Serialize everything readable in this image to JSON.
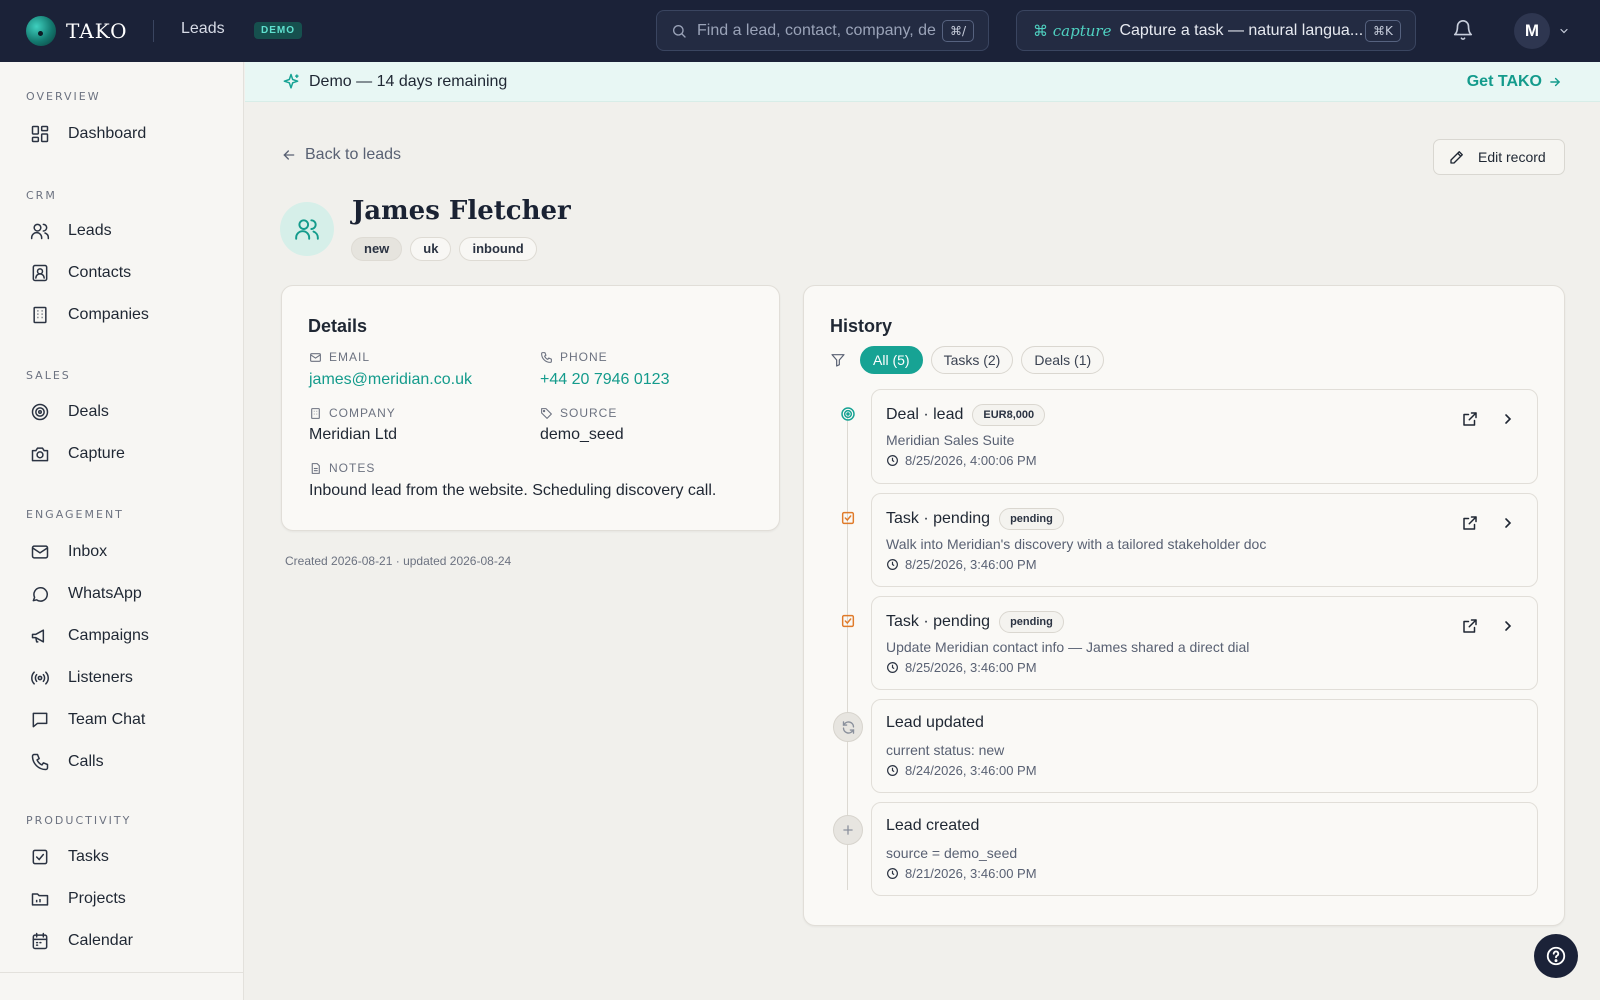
{
  "app": {
    "brand": "TAKO",
    "section": "Leads",
    "demo_badge": "DEMO",
    "search_placeholder": "Find a lead, contact, company, de",
    "search_shortcut": "⌘/",
    "capture_brand": "⌘ capture",
    "capture_text": "Capture a task — natural langua...",
    "capture_shortcut": "⌘K",
    "user_initial": "M"
  },
  "sidebar": {
    "sections": [
      {
        "heading": "OVERVIEW",
        "items": [
          {
            "label": "Dashboard",
            "icon": "dashboard-icon"
          }
        ]
      },
      {
        "heading": "CRM",
        "items": [
          {
            "label": "Leads",
            "icon": "users-icon"
          },
          {
            "label": "Contacts",
            "icon": "contact-card-icon"
          },
          {
            "label": "Companies",
            "icon": "building-icon"
          }
        ]
      },
      {
        "heading": "SALES",
        "items": [
          {
            "label": "Deals",
            "icon": "target-icon"
          },
          {
            "label": "Capture",
            "icon": "camera-icon"
          }
        ]
      },
      {
        "heading": "ENGAGEMENT",
        "items": [
          {
            "label": "Inbox",
            "icon": "mail-icon"
          },
          {
            "label": "WhatsApp",
            "icon": "chat-bubble-icon"
          },
          {
            "label": "Campaigns",
            "icon": "megaphone-icon"
          },
          {
            "label": "Listeners",
            "icon": "broadcast-icon"
          },
          {
            "label": "Team Chat",
            "icon": "message-square-icon"
          },
          {
            "label": "Calls",
            "icon": "phone-icon"
          }
        ]
      },
      {
        "heading": "PRODUCTIVITY",
        "items": [
          {
            "label": "Tasks",
            "icon": "checkbox-icon"
          },
          {
            "label": "Projects",
            "icon": "folder-icon"
          },
          {
            "label": "Calendar",
            "icon": "calendar-icon"
          }
        ]
      }
    ]
  },
  "banner": {
    "message": "Demo — 14 days remaining",
    "cta": "Get TAKO"
  },
  "page": {
    "back_label": "Back to leads",
    "edit_label": "Edit record",
    "lead_name": "James Fletcher",
    "tags": [
      "new",
      "uk",
      "inbound"
    ]
  },
  "details": {
    "title": "Details",
    "email_label": "EMAIL",
    "email": "james@meridian.co.uk",
    "phone_label": "PHONE",
    "phone": "+44 20 7946 0123",
    "company_label": "COMPANY",
    "company": "Meridian Ltd",
    "source_label": "SOURCE",
    "source": "demo_seed",
    "notes_label": "NOTES",
    "notes": "Inbound lead from the website. Scheduling discovery call.",
    "meta": "Created 2026-08-21 · updated 2026-08-24"
  },
  "history": {
    "title": "History",
    "filters": [
      "All (5)",
      "Tasks (2)",
      "Deals (1)"
    ],
    "active_filter": "All (5)",
    "entries": [
      {
        "title": "Deal · lead",
        "badge": "EUR8,000",
        "subtitle": "Meridian Sales Suite",
        "time": "8/25/2026, 4:00:06 PM",
        "icon": "target-icon"
      },
      {
        "title": "Task · pending",
        "badge": "pending",
        "subtitle": "Walk into Meridian's discovery with a tailored stakeholder doc",
        "time": "8/25/2026, 3:46:00 PM",
        "icon": "checkbox-icon"
      },
      {
        "title": "Task · pending",
        "badge": "pending",
        "subtitle": "Update Meridian contact info — James shared a direct dial",
        "time": "8/25/2026, 3:46:00 PM",
        "icon": "checkbox-icon"
      },
      {
        "title": "Lead updated",
        "badge": "",
        "subtitle": "current status: new",
        "time": "8/24/2026, 3:46:00 PM",
        "icon": "refresh-icon"
      },
      {
        "title": "Lead created",
        "badge": "",
        "subtitle": "source = demo_seed",
        "time": "8/21/2026, 3:46:00 PM",
        "icon": "plus-icon"
      }
    ]
  },
  "colors": {
    "accent": "#17a394",
    "topbar": "#1b2238",
    "task_orange": "#e07b2a"
  }
}
